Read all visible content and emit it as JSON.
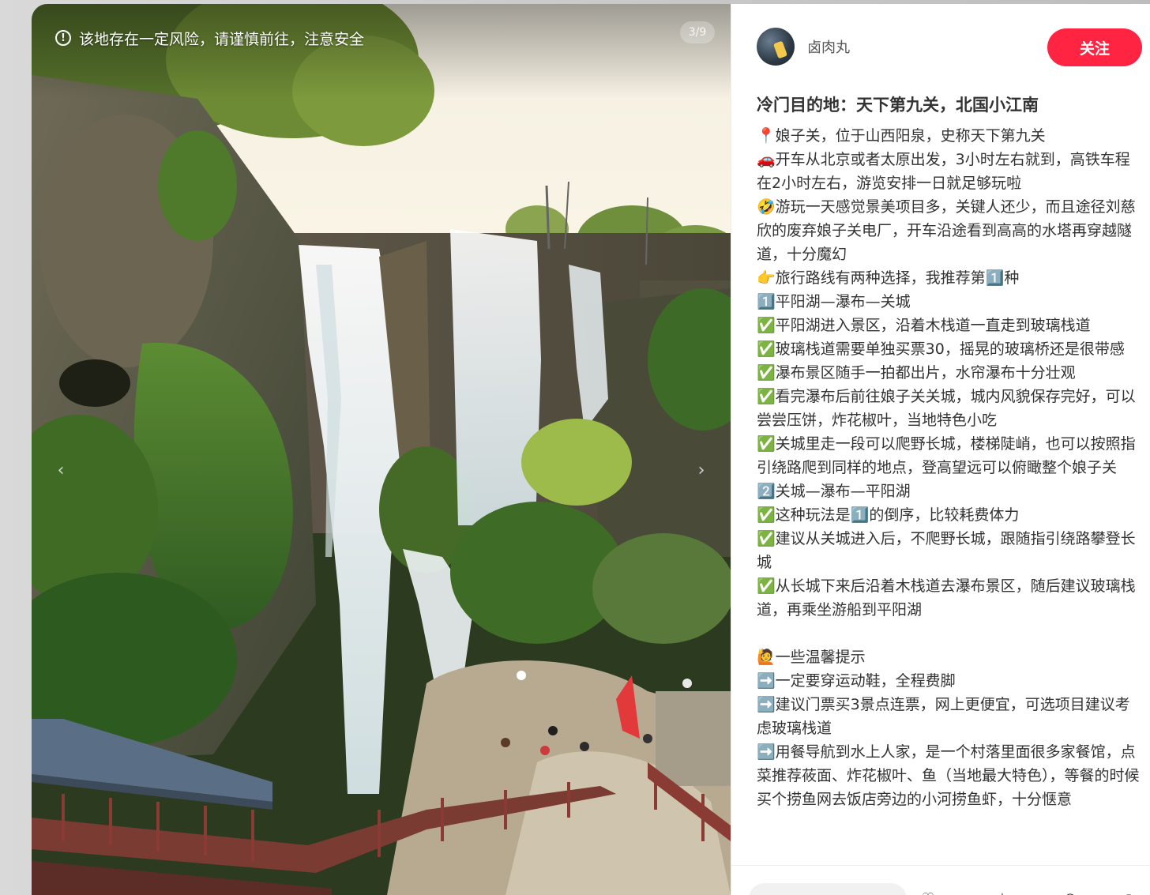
{
  "photo": {
    "warning_text": "该地存在一定风险，请谨慎前往，注意安全",
    "counter": "3/9",
    "prev_arrow": "‹",
    "next_arrow": "›"
  },
  "author": {
    "name": "卤肉丸"
  },
  "follow_label": "关注",
  "note": {
    "title": "冷门目的地：天下第九关，北国小江南",
    "lines": [
      "📍娘子关，位于山西阳泉，史称天下第九关",
      "🚗开车从北京或者太原出发，3小时左右就到，高铁车程在2小时左右，游览安排一日就足够玩啦",
      "🤣游玩一天感觉景美项目多，关键人还少，而且途径刘慈欣的废弃娘子关电厂，开车沿途看到高高的水塔再穿越隧道，十分魔幻",
      "👉旅行路线有两种选择，我推荐第1️⃣种",
      "1️⃣平阳湖—瀑布—关城",
      "✅平阳湖进入景区，沿着木栈道一直走到玻璃栈道",
      "✅玻璃栈道需要单独买票30，摇晃的玻璃桥还是很带感",
      "✅瀑布景区随手一拍都出片，水帘瀑布十分壮观",
      "✅看完瀑布后前往娘子关关城，城内风貌保存完好，可以尝尝压饼，炸花椒叶，当地特色小吃",
      "✅关城里走一段可以爬野长城，楼梯陡峭，也可以按照指引绕路爬到同样的地点，登高望远可以俯瞰整个娘子关",
      "2️⃣关城—瀑布—平阳湖",
      "✅这种玩法是1️⃣的倒序，比较耗费体力",
      "✅建议从关城进入后，不爬野长城，跟随指引绕路攀登长城",
      "✅从长城下来后沿着木栈道去瀑布景区，随后建议玻璃栈道，再乘坐游船到平阳湖",
      "",
      "🙋一些温馨提示",
      "➡️一定要穿运动鞋，全程费脚",
      "➡️建议门票买3景点连票，网上更便宜，可选项目建议考虑玻璃栈道",
      "➡️用餐导航到水上人家，是一个村落里面很多家餐馆，点菜推荐莜面、炸花椒叶、鱼（当地最大特色），等餐的时候买个捞鱼网去饭店旁边的小河捞鱼虾，十分惬意"
    ]
  },
  "icons": {
    "warning": "exclamation-circle-icon",
    "bar": [
      "star-icon",
      "like-icon",
      "comment-icon",
      "share-icon"
    ]
  },
  "colors": {
    "follow_bg": "#ff2442",
    "text": "#333333"
  }
}
